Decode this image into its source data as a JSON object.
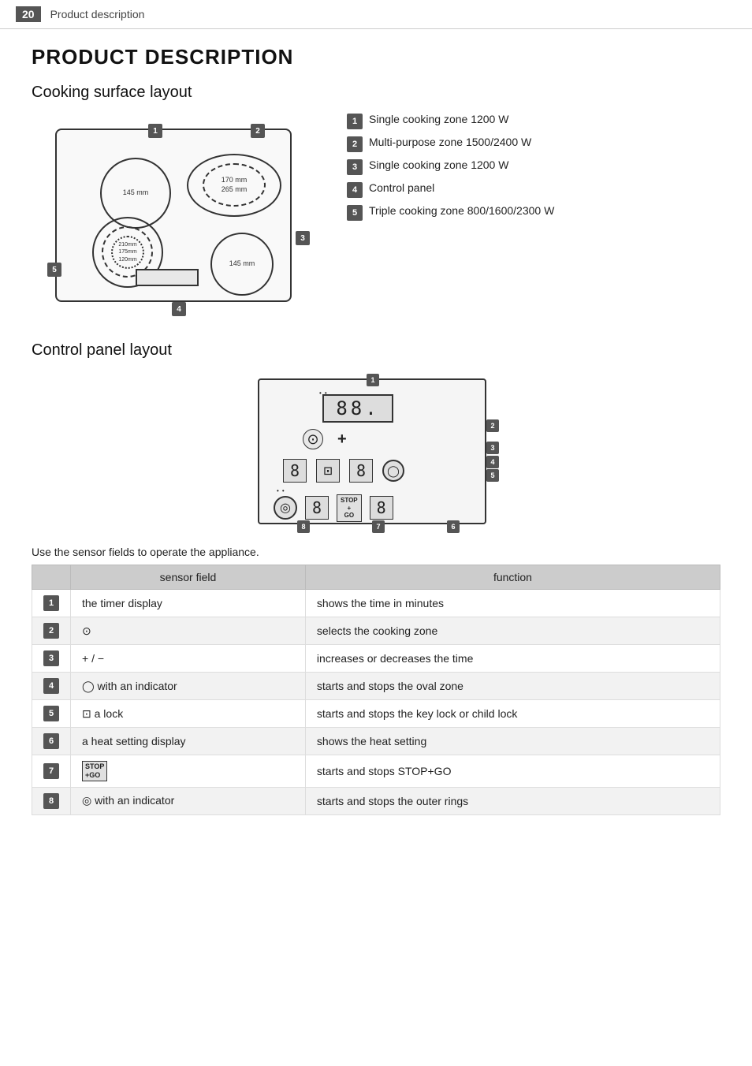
{
  "header": {
    "page_number": "20",
    "title": "Product description"
  },
  "main_title": "PRODUCT DESCRIPTION",
  "cooking_surface": {
    "section_title": "Cooking surface layout",
    "zones": [
      {
        "id": "1",
        "label": "Single cooking zone 1200 W"
      },
      {
        "id": "2",
        "label": "Multi-purpose zone 1500/2400 W"
      },
      {
        "id": "3",
        "label": "Single cooking zone 1200 W"
      },
      {
        "id": "4",
        "label": "Control panel"
      },
      {
        "id": "5",
        "label": "Triple cooking zone 800/1600/2300 W"
      }
    ],
    "zone1_dims": "145 mm",
    "zone2_dims_top": "170 mm",
    "zone2_dims_bot": "265 mm",
    "zone3_dims": "145 mm",
    "zone5_dims_outer": "210 mm",
    "zone5_dims_mid": "175 mm",
    "zone5_dims_inner": "120 mm"
  },
  "control_panel": {
    "section_title": "Control panel layout",
    "intro": "Use the sensor fields to operate the appliance.",
    "table_headers": [
      "sensor field",
      "function"
    ],
    "rows": [
      {
        "id": "1",
        "sensor": "the timer display",
        "function": "shows the time in minutes"
      },
      {
        "id": "2",
        "sensor": "⊙",
        "function": "selects the cooking zone"
      },
      {
        "id": "3",
        "sensor": "+ / −",
        "function": "increases or decreases the time"
      },
      {
        "id": "4",
        "sensor": "◯ with an indicator",
        "function": "starts and stops the oval zone"
      },
      {
        "id": "5",
        "sensor": "⊡ a lock",
        "function": "starts and stops the key lock or child lock"
      },
      {
        "id": "6",
        "sensor": "a heat setting display",
        "function": "shows the heat setting"
      },
      {
        "id": "7",
        "sensor": "STOP+GO",
        "function": "starts and stops STOP+GO"
      },
      {
        "id": "8",
        "sensor": "◎ with an indicator",
        "function": "starts and stops the outer rings"
      }
    ]
  }
}
